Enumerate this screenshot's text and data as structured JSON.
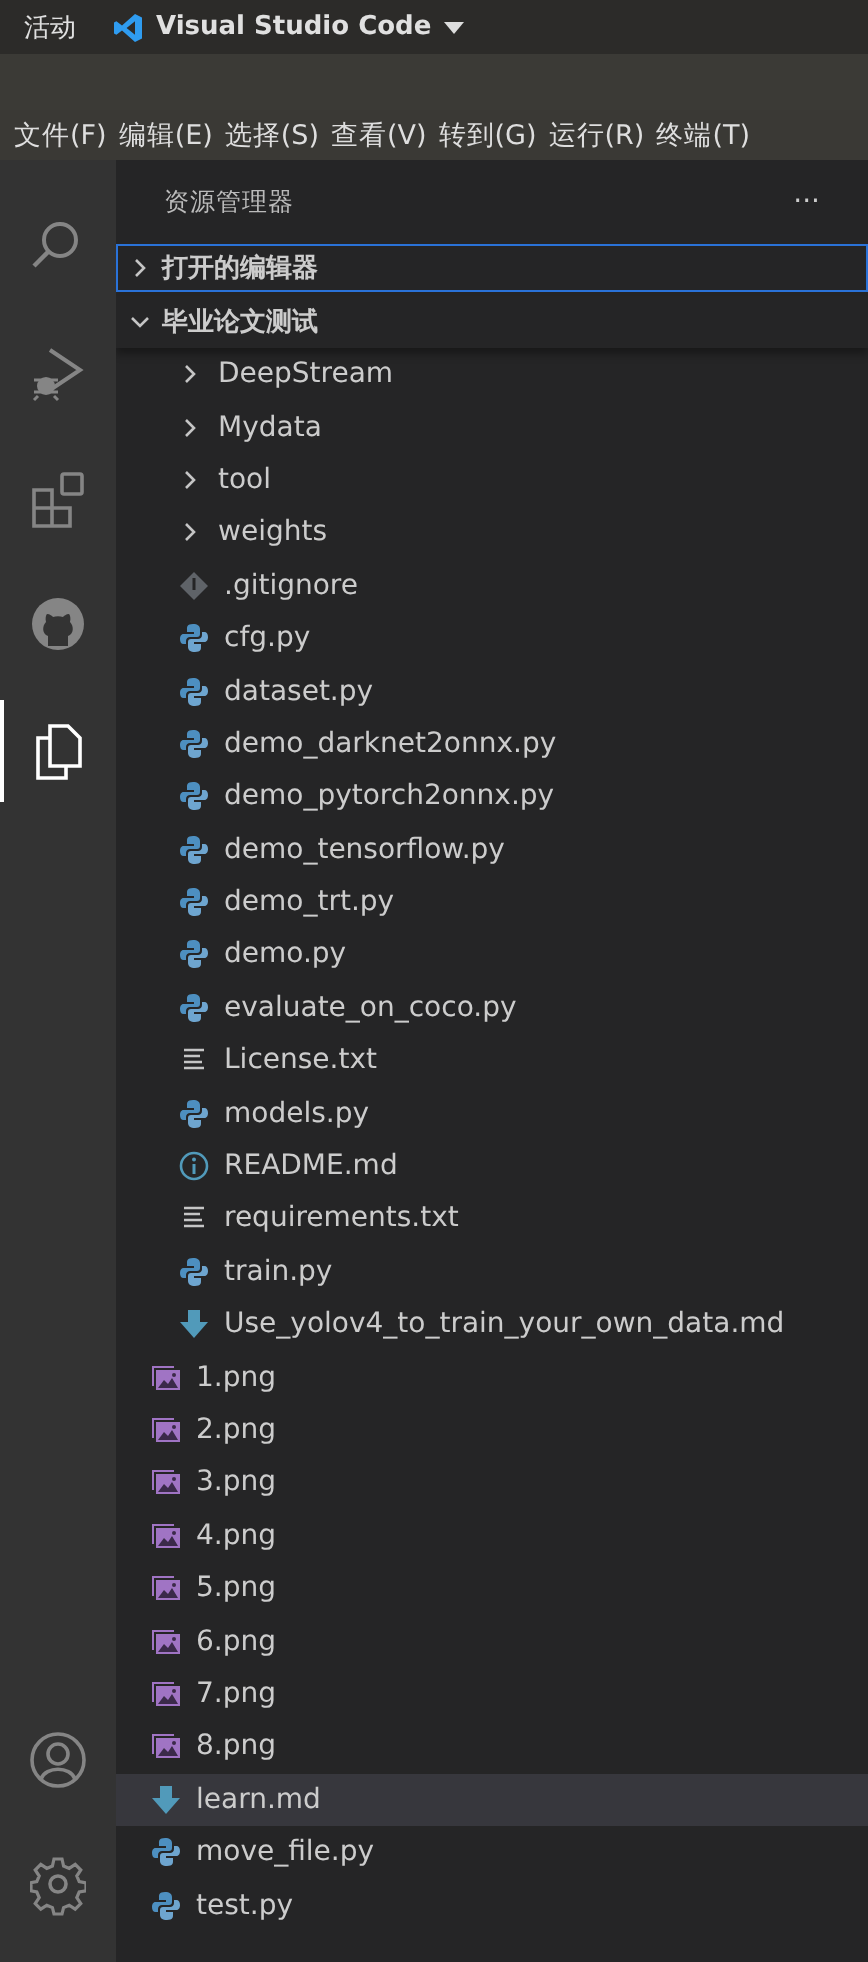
{
  "top_bar": {
    "activities": "活动",
    "app_name": "Visual Studio Code"
  },
  "menu_bar": [
    "文件(F)",
    "编辑(E)",
    "选择(S)",
    "查看(V)",
    "转到(G)",
    "运行(R)",
    "终端(T)"
  ],
  "activity_bar": [
    {
      "kind": "search",
      "selected": false
    },
    {
      "kind": "debug",
      "selected": false
    },
    {
      "kind": "extensions",
      "selected": false
    },
    {
      "kind": "github",
      "selected": false
    },
    {
      "kind": "explorer",
      "selected": true
    }
  ],
  "activity_bar_bottom": [
    {
      "kind": "account",
      "selected": false
    },
    {
      "kind": "settings",
      "selected": false
    }
  ],
  "sidebar": {
    "title": "资源管理器",
    "more": "···",
    "sections": [
      {
        "label": "打开的编辑器",
        "expanded": false,
        "focused": true
      },
      {
        "label": "毕业论文测试",
        "expanded": true,
        "focused": false
      }
    ],
    "tree": [
      {
        "children": [
          {
            "label": "DeepStream",
            "kind": "folder",
            "expanded": false,
            "selected": false
          },
          {
            "label": "Mydata",
            "kind": "folder",
            "expanded": false,
            "selected": false
          },
          {
            "label": "tool",
            "kind": "folder",
            "expanded": false,
            "selected": false
          },
          {
            "label": "weights",
            "kind": "folder",
            "expanded": false,
            "selected": false
          },
          {
            "label": ".gitignore",
            "kind": "git",
            "selected": false
          },
          {
            "label": "cfg.py",
            "kind": "python",
            "selected": false
          },
          {
            "label": "dataset.py",
            "kind": "python",
            "selected": false
          },
          {
            "label": "demo_darknet2onnx.py",
            "kind": "python",
            "selected": false
          },
          {
            "label": "demo_pytorch2onnx.py",
            "kind": "python",
            "selected": false
          },
          {
            "label": "demo_tensorflow.py",
            "kind": "python",
            "selected": false
          },
          {
            "label": "demo_trt.py",
            "kind": "python",
            "selected": false
          },
          {
            "label": "demo.py",
            "kind": "python",
            "selected": false
          },
          {
            "label": "evaluate_on_coco.py",
            "kind": "python",
            "selected": false
          },
          {
            "label": "License.txt",
            "kind": "text",
            "selected": false
          },
          {
            "label": "models.py",
            "kind": "python",
            "selected": false
          },
          {
            "label": "README.md",
            "kind": "info",
            "selected": false
          },
          {
            "label": "requirements.txt",
            "kind": "text",
            "selected": false
          },
          {
            "label": "train.py",
            "kind": "python",
            "selected": false
          },
          {
            "label": "Use_yolov4_to_train_your_own_data.md",
            "kind": "markdown",
            "selected": false
          }
        ]
      },
      {
        "label": "1.png",
        "kind": "image",
        "selected": false
      },
      {
        "label": "2.png",
        "kind": "image",
        "selected": false
      },
      {
        "label": "3.png",
        "kind": "image",
        "selected": false
      },
      {
        "label": "4.png",
        "kind": "image",
        "selected": false
      },
      {
        "label": "5.png",
        "kind": "image",
        "selected": false
      },
      {
        "label": "6.png",
        "kind": "image",
        "selected": false
      },
      {
        "label": "7.png",
        "kind": "image",
        "selected": false
      },
      {
        "label": "8.png",
        "kind": "image",
        "selected": false
      },
      {
        "label": "learn.md",
        "kind": "markdown",
        "selected": true
      },
      {
        "label": "move_file.py",
        "kind": "python",
        "selected": false
      },
      {
        "label": "test.py",
        "kind": "python",
        "selected": false
      }
    ]
  }
}
